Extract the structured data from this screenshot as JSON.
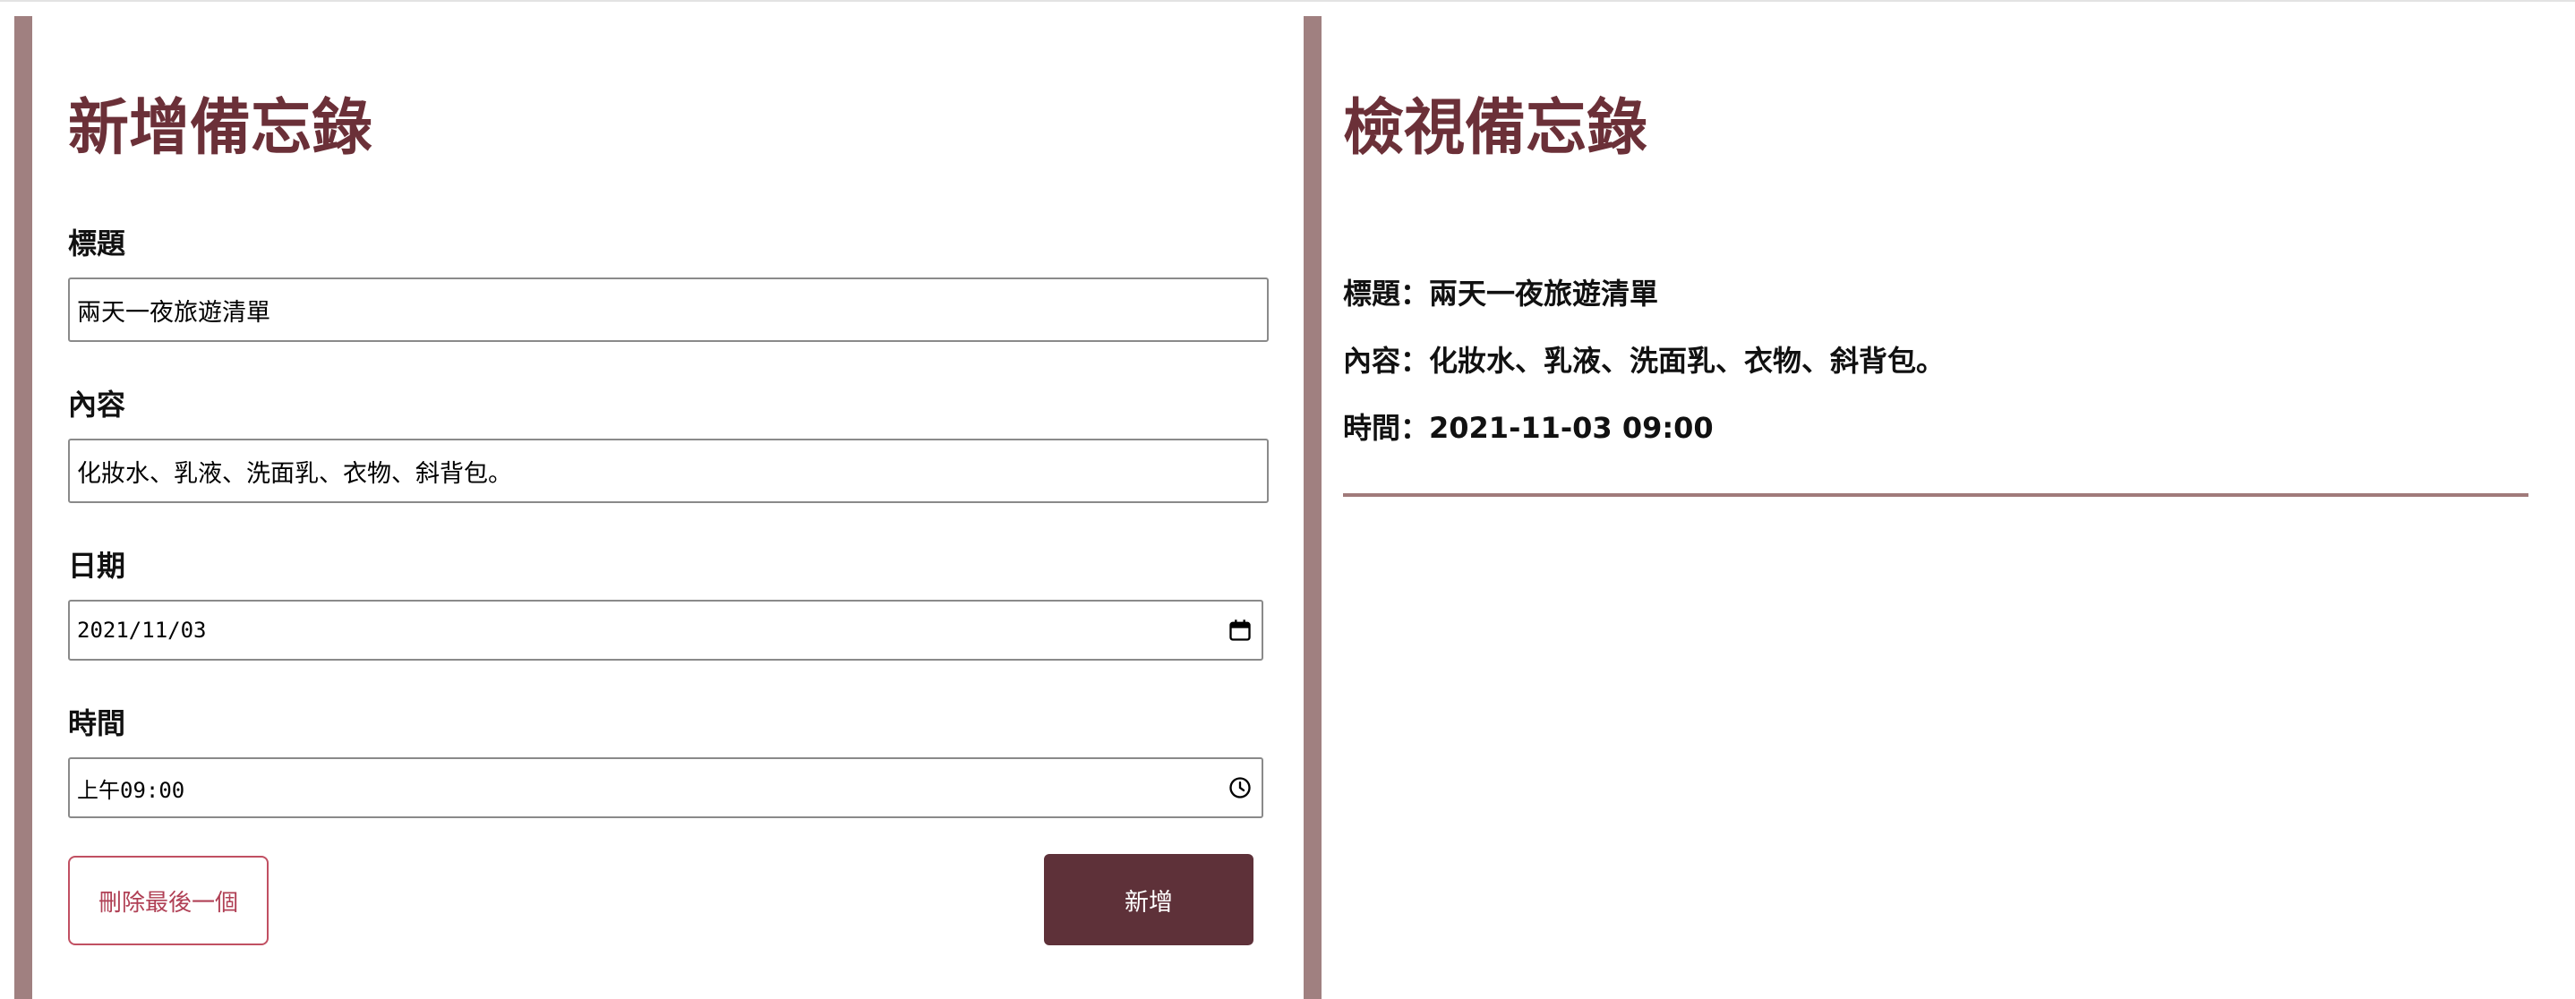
{
  "add_form": {
    "heading": "新增備忘錄",
    "title_label": "標題",
    "title_value": "兩天一夜旅遊清單",
    "content_label": "內容",
    "content_value": "化妝水、乳液、洗面乳、衣物、斜背包。",
    "date_label": "日期",
    "date_value": "2021/11/03",
    "time_label": "時間",
    "time_value": "上午09:00",
    "delete_last_button": "刪除最後一個",
    "add_button": "新增"
  },
  "view_panel": {
    "heading": "檢視備忘錄",
    "memos": [
      {
        "title_line": "標題：兩天一夜旅遊清單",
        "content_line": "內容：化妝水、乳液、洗面乳、衣物、斜背包。",
        "time_line": "時間：2021-11-03 09:00"
      }
    ]
  },
  "icons": {
    "date_picker": "calendar-icon",
    "time_picker": "clock-icon"
  },
  "colors": {
    "heading": "#6b3038",
    "panel_border": "#a08080",
    "add_button_bg": "#5e3139",
    "delete_button_border": "#c15062",
    "divider": "#a07a7a"
  }
}
